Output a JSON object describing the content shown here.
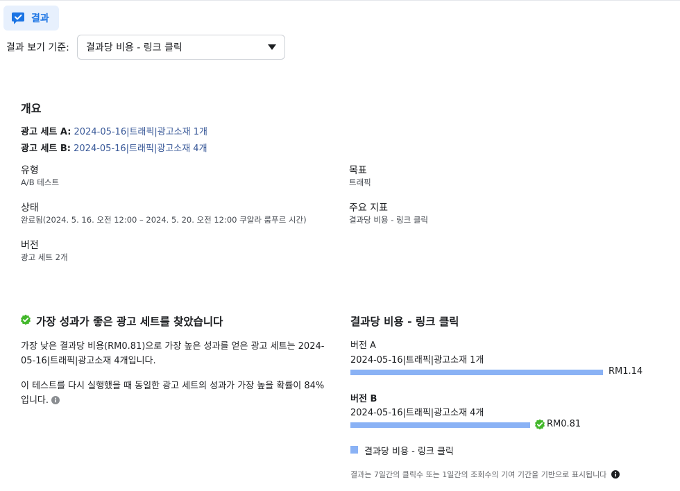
{
  "tab": {
    "label": "결과"
  },
  "view_by": {
    "label": "결과 보기 기준:",
    "selected": "결과당 비용 - 링크 클릭"
  },
  "overview": {
    "title": "개요",
    "ad_sets": [
      {
        "key": "광고 세트 A:",
        "value": " 2024-05-16|트래픽|광고소재 1개"
      },
      {
        "key": "광고 세트 B:",
        "value": " 2024-05-16|트래픽|광고소재 4개"
      }
    ],
    "fields": {
      "type": {
        "label": "유형",
        "value": "A/B 테스트"
      },
      "goal": {
        "label": "목표",
        "value": "트래픽"
      },
      "status": {
        "label": "상태",
        "value": "완료됨(2024. 5. 16. 오전 12:00 – 2024. 5. 20. 오전 12:00 쿠알라 룸푸르 시간)"
      },
      "key_metric": {
        "label": "주요 지표",
        "value": "결과당 비용 - 링크 클릭"
      },
      "versions": {
        "label": "버전",
        "value": "광고 세트 2개"
      }
    }
  },
  "winner": {
    "title": "가장 성과가 좋은 광고 세트를 찾았습니다",
    "paragraph1": "가장 낮은 결과당 비용(RM0.81)으로 가장 높은 성과를 얻은 광고 세트는 2024-05-16|트래픽|광고소재 4개입니다.",
    "paragraph2": "이 테스트를 다시 실행했을 때 동일한 광고 세트의 성과가 가장 높을 확률이 84%입니다."
  },
  "chart_data": {
    "type": "bar",
    "title": "결과당 비용 - 링크 클릭",
    "orientation": "horizontal",
    "categories": [
      "버전 A",
      "버전 B"
    ],
    "category_subtitles": [
      "2024-05-16|트래픽|광고소재 1개",
      "2024-05-16|트래픽|광고소재 4개"
    ],
    "values": [
      1.14,
      0.81
    ],
    "value_labels": [
      "RM1.14",
      "RM0.81"
    ],
    "winner_index": 1,
    "legend": [
      "결과당 비용 - 링크 클릭"
    ],
    "color": "#8ab2f5"
  },
  "footnote": "결과는 7일간의 클릭수 또는 1일간의 조회수의 기여 기간을 기반으로 표시됩니다",
  "colors": {
    "accent": "#1b74e4",
    "success": "#42b72a",
    "link": "#385898"
  }
}
